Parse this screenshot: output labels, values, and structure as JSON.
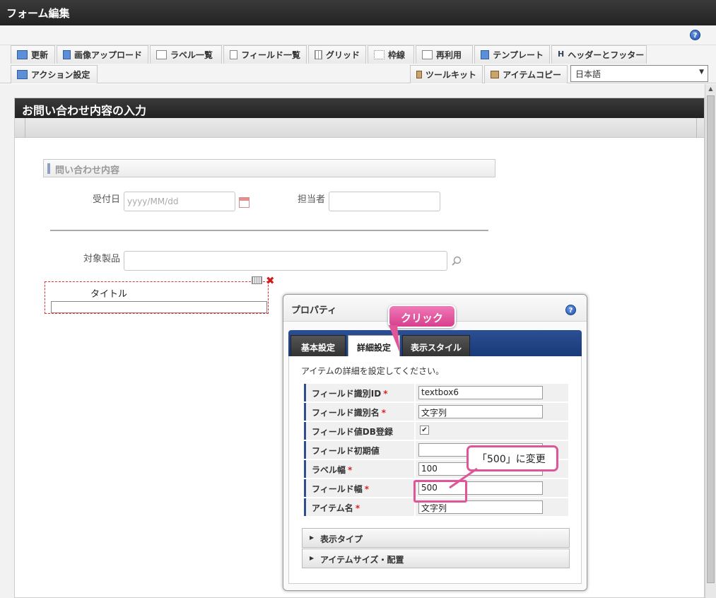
{
  "window": {
    "title": "フォーム編集"
  },
  "toolbar": {
    "row1": [
      {
        "label": "更新",
        "icon": "refresh-icon"
      },
      {
        "label": "画像アップロード",
        "icon": "image-upload-icon"
      },
      {
        "label": "ラベル一覧",
        "icon": "label-list-icon"
      },
      {
        "label": "フィールド一覧",
        "icon": "field-list-icon"
      },
      {
        "label": "グリッド",
        "icon": "grid-icon"
      },
      {
        "label": "枠線",
        "icon": "border-icon"
      },
      {
        "label": "再利用",
        "icon": "reuse-icon"
      },
      {
        "label": "テンプレート",
        "icon": "template-icon"
      },
      {
        "label": "ヘッダーとフッター",
        "icon": "header-footer-icon"
      }
    ],
    "row2": {
      "action": "アクション設定",
      "toolkit": "ツールキット",
      "item_copy": "アイテムコピー",
      "language": "日本語"
    }
  },
  "form": {
    "title": "お問い合わせ内容の入力",
    "section": "問い合わせ内容",
    "fields": {
      "received_date_label": "受付日",
      "received_date_placeholder": "yyyy/MM/dd",
      "person_label": "担当者",
      "product_label": "対象製品",
      "title_label": "タイトル"
    }
  },
  "properties": {
    "title": "プロパティ",
    "tabs": [
      "基本設定",
      "詳細設定",
      "表示スタイル"
    ],
    "active_tab": "詳細設定",
    "description": "アイテムの詳細を設定してください。",
    "rows": [
      {
        "key": "フィールド識別ID",
        "required": true,
        "value": "textbox6"
      },
      {
        "key": "フィールド識別名",
        "required": true,
        "value": "文字列"
      },
      {
        "key": "フィールド値DB登録",
        "required": false,
        "checked": true
      },
      {
        "key": "フィールド初期値",
        "required": false,
        "value": ""
      },
      {
        "key": "ラベル幅",
        "required": true,
        "value": "100"
      },
      {
        "key": "フィールド幅",
        "required": true,
        "value": "500"
      },
      {
        "key": "アイテム名",
        "required": true,
        "value": "文字列"
      }
    ],
    "required_mark": "*",
    "accordions": [
      "表示タイプ",
      "アイテムサイズ・配置"
    ]
  },
  "annotations": {
    "click": "クリック",
    "change": "「500」に変更"
  },
  "colors": {
    "callout_pink": "#e0559a",
    "tab_bar_blue": "#2a4f93",
    "title_dark": "#2b2b2b"
  }
}
